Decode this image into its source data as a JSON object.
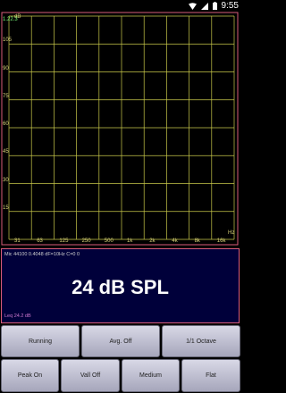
{
  "status_bar": {
    "time": "9:55",
    "icons": [
      "wifi-icon",
      "signal-icon",
      "battery-icon"
    ]
  },
  "plot": {
    "db_unit": "dB",
    "freq_unit": "Hz",
    "live_value": "1.22.3",
    "db_labels": [
      "105",
      "90",
      "75",
      "60",
      "45",
      "30",
      "15"
    ],
    "freq_labels": [
      "31",
      "63",
      "125",
      "250",
      "500",
      "1k",
      "2k",
      "4k",
      "8k",
      "16k"
    ],
    "grid_color": "#c8c84a",
    "frame_color": "#d95c7a"
  },
  "spl": {
    "info": "Mic 44100 0.4048 dF=10Hz C=0 0",
    "value": "24 dB SPL",
    "leq": "Leq 24.2 dB"
  },
  "buttons": {
    "running": "Running",
    "avg": "Avg. Off",
    "octave": "1/1 Octave",
    "peak": "Peak On",
    "vall": "Vall Off",
    "medium": "Medium",
    "flat": "Flat"
  }
}
